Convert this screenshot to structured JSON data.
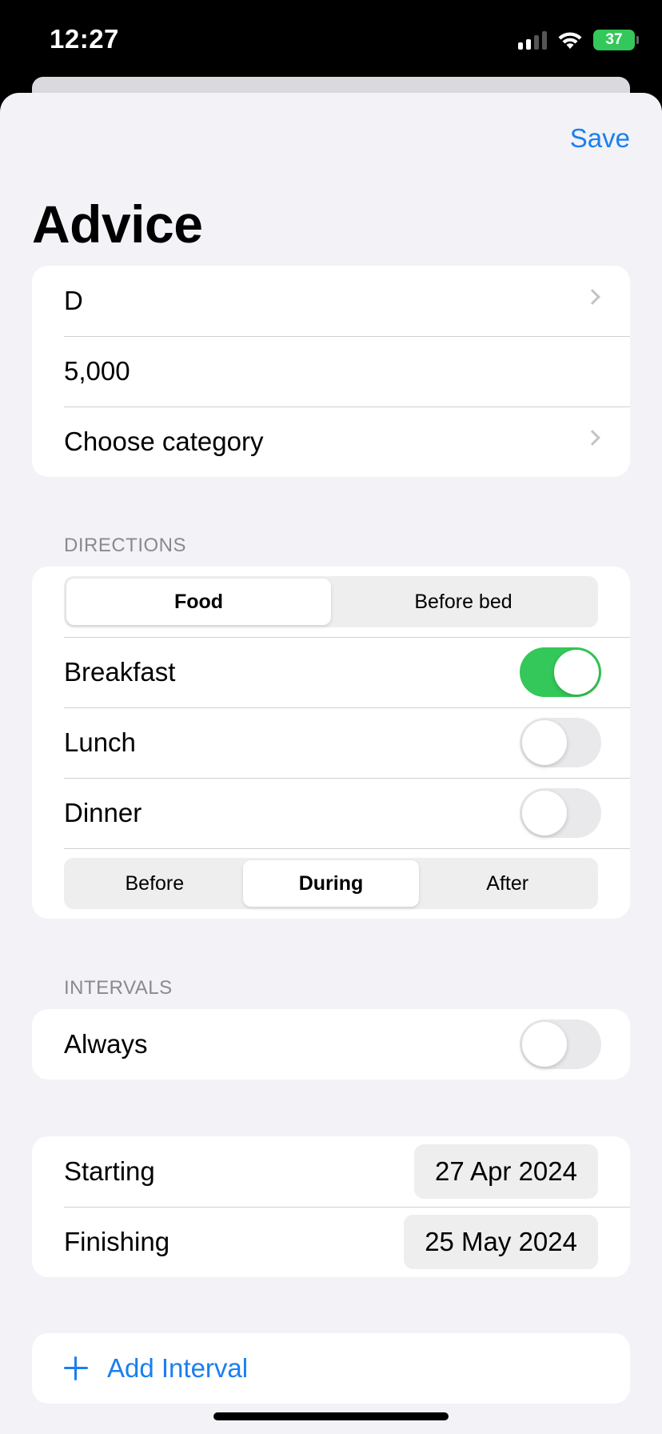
{
  "status_bar": {
    "time": "12:27",
    "battery": "37"
  },
  "toolbar": {
    "save_label": "Save"
  },
  "title": "Advice",
  "details": {
    "name": "D",
    "amount": "5,000",
    "category": "Choose category"
  },
  "directions": {
    "header": "DIRECTIONS",
    "mode_segments": [
      {
        "label": "Food",
        "selected": true
      },
      {
        "label": "Before bed",
        "selected": false
      }
    ],
    "meals": [
      {
        "label": "Breakfast",
        "on": true
      },
      {
        "label": "Lunch",
        "on": false
      },
      {
        "label": "Dinner",
        "on": false
      }
    ],
    "timing_segments": [
      {
        "label": "Before",
        "selected": false
      },
      {
        "label": "During",
        "selected": true
      },
      {
        "label": "After",
        "selected": false
      }
    ]
  },
  "intervals": {
    "header": "INTERVALS",
    "always_label": "Always",
    "always_on": false
  },
  "dates": {
    "starting_label": "Starting",
    "starting_value": "27 Apr 2024",
    "finishing_label": "Finishing",
    "finishing_value": "25 May 2024"
  },
  "add_interval_label": "Add Interval",
  "colors": {
    "accent": "#1a7ff0",
    "toggle_on": "#34c759"
  },
  "icons": [
    "chevron-right-icon",
    "plus-icon",
    "signal-icon",
    "wifi-icon",
    "battery-icon"
  ]
}
